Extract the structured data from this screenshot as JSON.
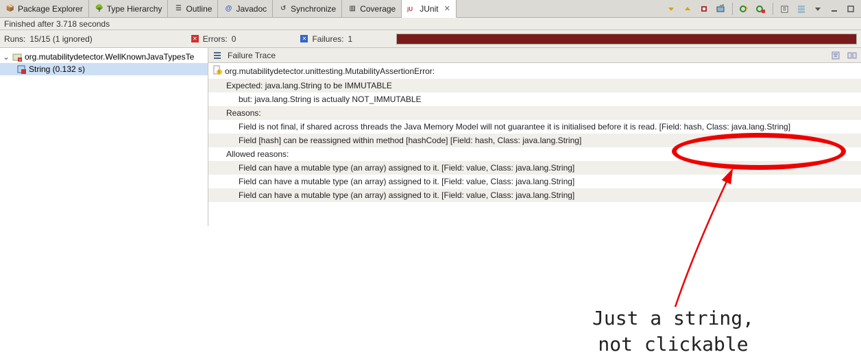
{
  "tabs": [
    {
      "label": "Package Explorer",
      "icon": "📦"
    },
    {
      "label": "Type Hierarchy",
      "icon": "🌳"
    },
    {
      "label": "Outline",
      "icon": "☰"
    },
    {
      "label": "Javadoc",
      "icon": "@"
    },
    {
      "label": "Synchronize",
      "icon": "↺"
    },
    {
      "label": "Coverage",
      "icon": "▥"
    },
    {
      "label": "JUnit",
      "icon": "jU"
    }
  ],
  "active_tab": 6,
  "status": "Finished after 3.718 seconds",
  "counters": {
    "runs_label": "Runs:",
    "runs_value": "15/15 (1 ignored)",
    "errors_label": "Errors:",
    "errors_value": "0",
    "fail_label": "Failures:",
    "fail_value": "1"
  },
  "tree": {
    "root_label": "org.mutabilitydetector.WellKnownJavaTypesTe",
    "child_label": "String (0.132 s)"
  },
  "trace": {
    "title": "Failure Trace",
    "lines": [
      {
        "indent": 0,
        "alt": false,
        "icon": true,
        "text": "org.mutabilitydetector.unittesting.MutabilityAssertionError:"
      },
      {
        "indent": 1,
        "alt": true,
        "icon": false,
        "text": "Expected: java.lang.String to be IMMUTABLE"
      },
      {
        "indent": 2,
        "alt": false,
        "icon": false,
        "text": "but: java.lang.String is actually NOT_IMMUTABLE"
      },
      {
        "indent": 1,
        "alt": true,
        "icon": false,
        "text": "Reasons:"
      },
      {
        "indent": 2,
        "alt": false,
        "icon": false,
        "text": "Field is not final, if shared across threads the Java Memory Model will not guarantee it is initialised before it is read. [Field: hash, Class: java.lang.String]"
      },
      {
        "indent": 2,
        "alt": true,
        "icon": false,
        "text": "Field [hash] can be reassigned within method [hashCode] [Field: hash, Class: java.lang.String]"
      },
      {
        "indent": 1,
        "alt": false,
        "icon": false,
        "text": "Allowed reasons:"
      },
      {
        "indent": 2,
        "alt": true,
        "icon": false,
        "text": "Field can have a mutable type (an array) assigned to it. [Field: value, Class: java.lang.String]"
      },
      {
        "indent": 2,
        "alt": false,
        "icon": false,
        "text": "Field can have a mutable type (an array) assigned to it. [Field: value, Class: java.lang.String]"
      },
      {
        "indent": 2,
        "alt": true,
        "icon": false,
        "text": "Field can have a mutable type (an array) assigned to it. [Field: value, Class: java.lang.String]"
      }
    ]
  },
  "annotation": {
    "line1": "Just a string,",
    "line2": "not clickable"
  }
}
